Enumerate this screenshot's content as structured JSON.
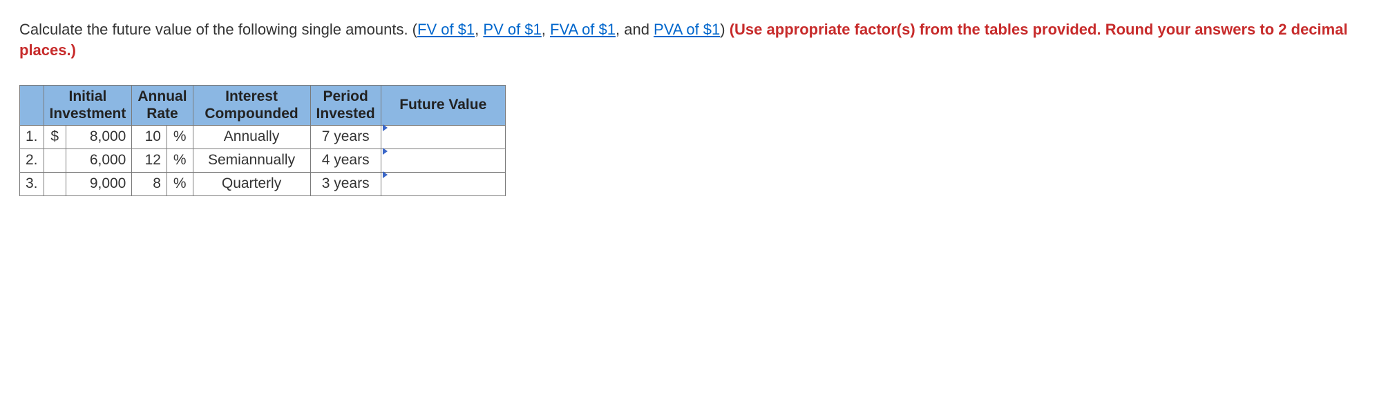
{
  "question": {
    "prefix": "Calculate the future value of the following single amounts. (",
    "link1": "FV of $1",
    "sep1": ", ",
    "link2": "PV of $1",
    "sep2": ", ",
    "link3": "FVA of $1",
    "sep3": ", and ",
    "link4": "PVA of $1",
    "suffix_plain": ") ",
    "bold_red": "(Use appropriate factor(s) from the tables provided. Round your answers to 2 decimal places.)"
  },
  "table": {
    "headers": {
      "initial": "Initial Investment",
      "rate": "Annual Rate",
      "compounded": "Interest Compounded",
      "period": "Period Invested",
      "fv": "Future Value"
    },
    "rows": [
      {
        "num": "1.",
        "currency": "$",
        "amount": "8,000",
        "rate_val": "10",
        "rate_sym": "%",
        "compounded": "Annually",
        "period": "7 years",
        "fv": ""
      },
      {
        "num": "2.",
        "currency": "",
        "amount": "6,000",
        "rate_val": "12",
        "rate_sym": "%",
        "compounded": "Semiannually",
        "period": "4 years",
        "fv": ""
      },
      {
        "num": "3.",
        "currency": "",
        "amount": "9,000",
        "rate_val": "8",
        "rate_sym": "%",
        "compounded": "Quarterly",
        "period": "3 years",
        "fv": ""
      }
    ]
  }
}
